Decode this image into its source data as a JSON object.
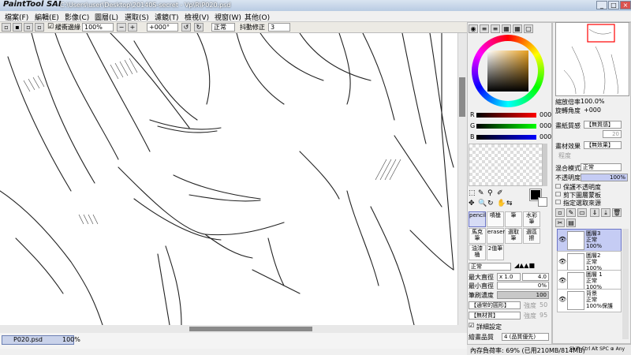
{
  "app": {
    "logo": "PaintTool SAI",
    "title": "C:\\Users\\user\\Desktop\\20140S-secret - Vp\\R\\P020.psd"
  },
  "menu": [
    "檔案(F)",
    "編輯(E)",
    "影像(C)",
    "圖層(L)",
    "選取(S)",
    "濾鏡(T)",
    "檢視(V)",
    "視窗(W)",
    "其他(O)"
  ],
  "toolbar": {
    "antialias_label": "緩衝邊緣",
    "zoom": "100%",
    "rotation": "+000°",
    "blend": "正常",
    "stabilizer_label": "抖動修正",
    "stabilizer": "3"
  },
  "document_tab": {
    "name": "P020.psd",
    "zoom": "100%"
  },
  "color": {
    "r_label": "R",
    "r_value": "000",
    "g_label": "G",
    "g_value": "000",
    "b_label": "B",
    "b_value": "000",
    "current": "#000000"
  },
  "brushes": [
    {
      "label": "pencil"
    },
    {
      "label": "噴槍"
    },
    {
      "label": "筆"
    },
    {
      "label": "水彩筆"
    },
    {
      "label": "馬克筆"
    },
    {
      "label": "eraser"
    },
    {
      "label": "選取筆"
    },
    {
      "label": "選區擦"
    },
    {
      "label": "油漆桶"
    },
    {
      "label": "2值筆"
    }
  ],
  "brush_settings": {
    "mode": "正常",
    "max_size_label": "最大直徑",
    "max_size_mult": "x 1.0",
    "max_size": "4.0",
    "min_size_label": "最小直徑",
    "min_size": "0%",
    "density_label": "筆刷濃度",
    "density": "100",
    "shape": "【通常的圓形】",
    "shape_strength_label": "強度",
    "shape_strength": "50",
    "texture": "【無材質】",
    "texture_strength_label": "強度",
    "texture_strength": "95",
    "detail_label": "詳細設定",
    "quality_label": "繪畫品質",
    "quality": "4 (品質優先)"
  },
  "navigator": {
    "zoom_label": "縮放倍率",
    "zoom": "100.0%",
    "angle_label": "旋轉角度",
    "angle": "+000"
  },
  "layer_props": {
    "paper_label": "畫紙質感",
    "paper": "【無質感】",
    "paper_strength": "20",
    "effect_label": "畫材效果",
    "effect": "【無效果】",
    "effect_strength": "程度",
    "blend_label": "混合模式",
    "blend": "正常",
    "opacity_label": "不透明度",
    "opacity": "100%",
    "protect_label": "保護不透明度",
    "clip_label": "剪下圖層蒙板",
    "source_label": "指定選取來源"
  },
  "layers": [
    {
      "name": "圖層3",
      "mode": "正常",
      "opacity": "100%",
      "selected": true
    },
    {
      "name": "圖層2",
      "mode": "正常",
      "opacity": "100%",
      "selected": false
    },
    {
      "name": "圖層 1",
      "mode": "正常",
      "opacity": "100%",
      "selected": false
    },
    {
      "name": "背景",
      "mode": "正常",
      "opacity": "100%保護",
      "selected": false
    }
  ],
  "status": {
    "memory": "內存負荷率: 69% (已用210MB/814MB)",
    "keys": "Shift Ctrl Alt SPC ⊕ Any"
  }
}
